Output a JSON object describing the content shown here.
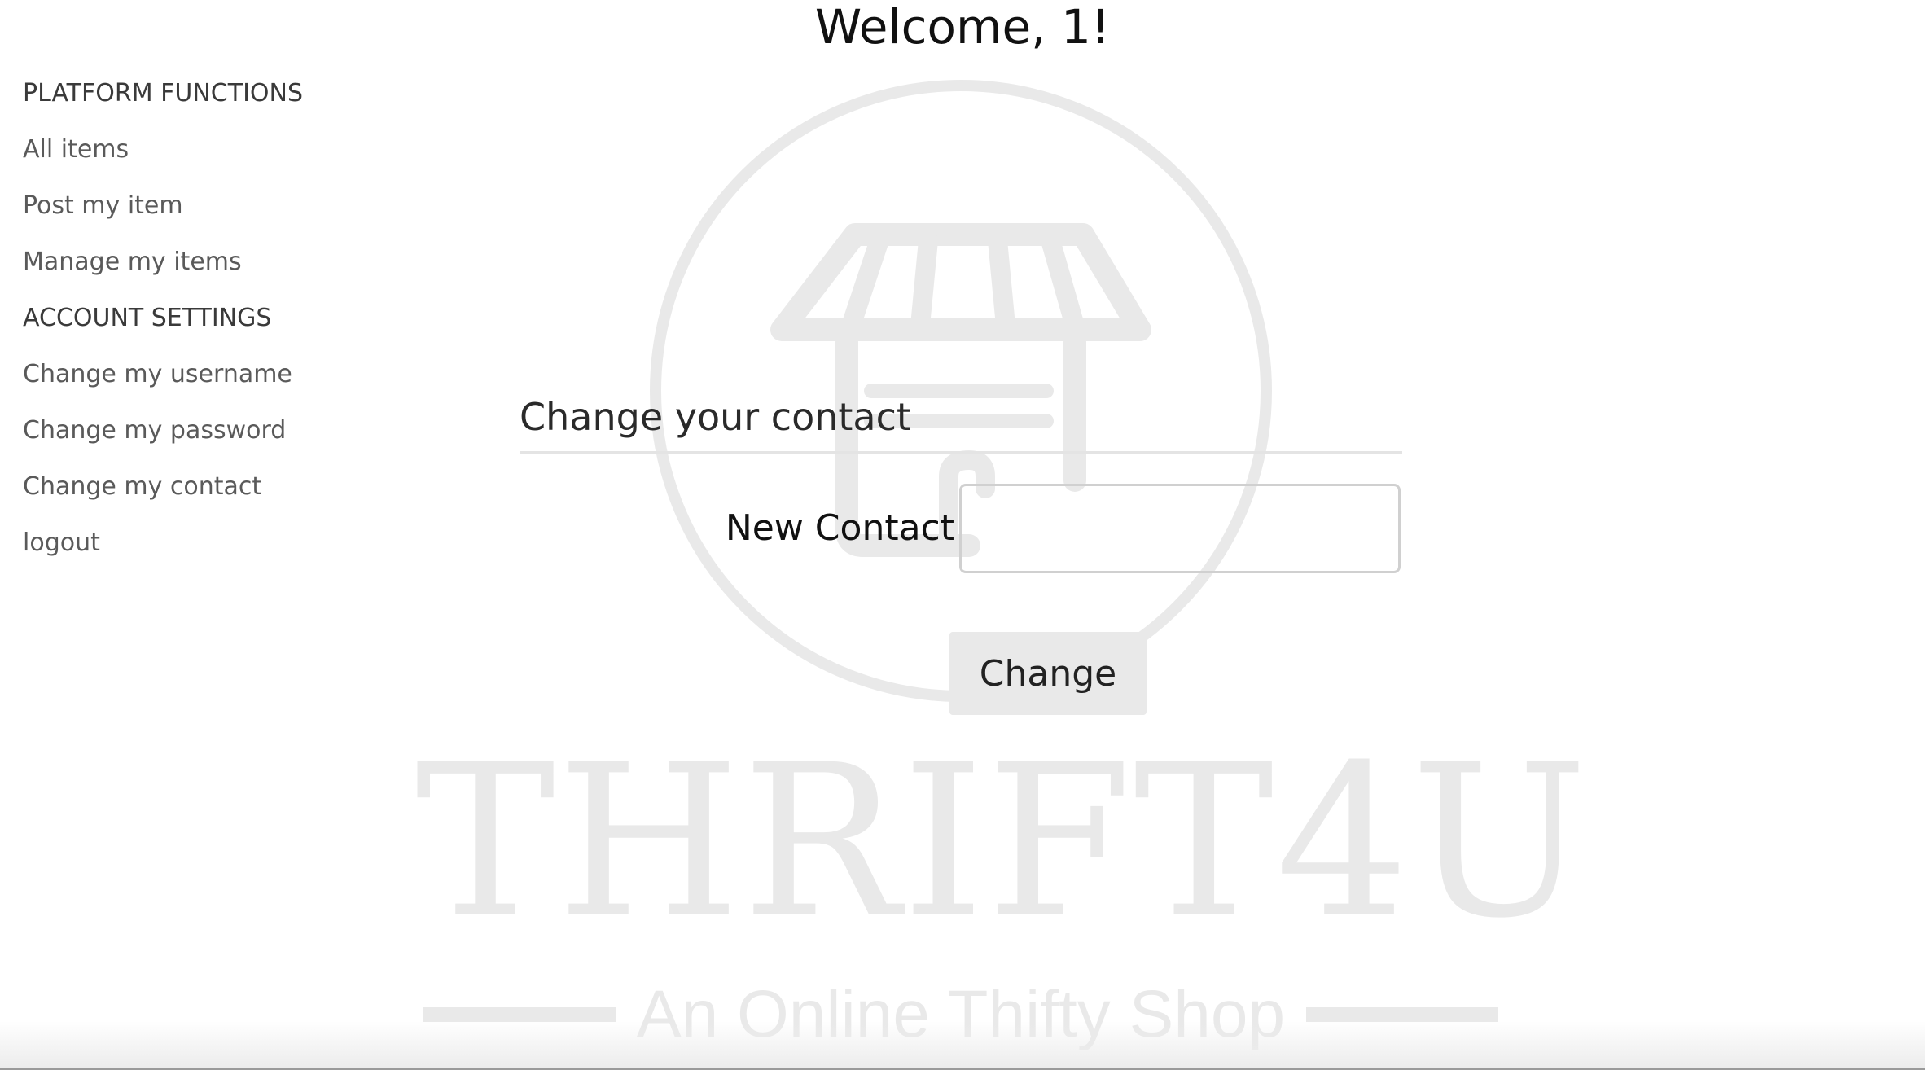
{
  "page": {
    "title": "Welcome, 1!"
  },
  "sidebar": {
    "sections": [
      {
        "heading": "PLATFORM FUNCTIONS",
        "items": [
          "All items",
          "Post my item",
          "Manage my items"
        ]
      },
      {
        "heading": "ACCOUNT SETTINGS",
        "items": [
          "Change my username",
          "Change my password",
          "Change my contact",
          "logout"
        ]
      }
    ]
  },
  "form": {
    "title": "Change your contact",
    "field_label": "New Contact",
    "field_value": "",
    "submit_label": "Change"
  },
  "watermark": {
    "brand": "THRIFT4U",
    "tagline": "An Online Thifty Shop",
    "color": "#e9e9e9",
    "icon": "storefront-icon"
  }
}
